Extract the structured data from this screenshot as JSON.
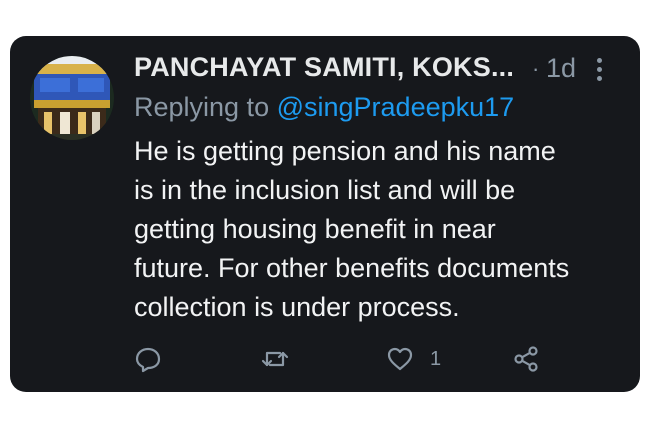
{
  "tweet": {
    "display_name": "PANCHAYAT SAMITI, KOKS...",
    "separator": "·",
    "time": "1d",
    "reply_prefix": "Replying to ",
    "reply_handle": "@singPradeepku17",
    "body_lines": [
      "He is getting pension and his name",
      "is in the inclusion list and will be",
      "getting housing benefit in near",
      "future. For other benefits documents",
      "collection is under process."
    ],
    "like_count": "1"
  },
  "colors": {
    "card_bg": "#16181c",
    "text_primary": "#e7e9ea",
    "text_secondary": "#8b98a5",
    "link": "#1d9bf0"
  },
  "icons": {
    "more": "more-vertical-icon",
    "reply": "comment-icon",
    "retweet": "retweet-icon",
    "like": "heart-icon",
    "share": "share-icon"
  }
}
